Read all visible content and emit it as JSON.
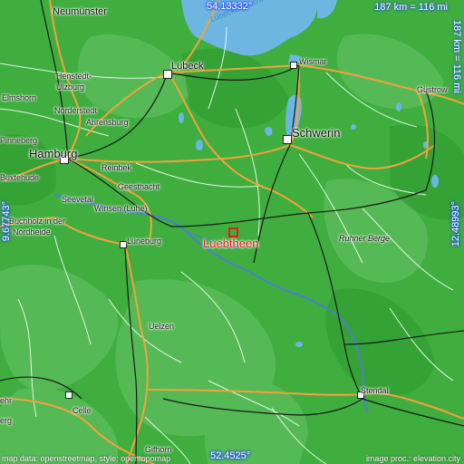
{
  "map": {
    "target": "Luebtheen",
    "colors": {
      "land": "#3fae3f",
      "land_light": "#6ec36e",
      "water": "#6db6e2",
      "road_main": "#f4a13c",
      "road_minor": "#ffffff",
      "rail": "#222222",
      "river": "#4c7fd0",
      "target": "#e81a1a"
    },
    "coords": {
      "top": "54.13332°",
      "bottom": "52.4525°",
      "left": "9.67743°",
      "right": "12.48993°"
    },
    "scale": {
      "horizontal": "187 km = 116 mi",
      "vertical": "187 km = 116 mi"
    },
    "attribution_left": "map data: openstreetmap, style: opentopomap",
    "attribution_right": "image proc.: elevation.city",
    "sea_label": "Lübecker Bucht",
    "places": {
      "neumunster": "Neumünster",
      "lubeck": "Lübeck",
      "wismar": "Wismar",
      "henstedt": "Henstedt-",
      "ulzburg": "Ulzburg",
      "norderstedt": "Norderstedt",
      "elmshorn": "Elmshorn",
      "ahrensburg": "Ahrensburg",
      "pinneberg": "Pinneberg",
      "hamburg": "Hamburg",
      "reinbek": "Reinbek",
      "buxtehude": "Buxtehude",
      "geesthacht": "Geesthacht",
      "seevetal": "Seevetal",
      "winsen": "Winsen (Luhe)",
      "buchholz": "Buchholz in der",
      "nordheide": "Nordheide",
      "luneburg": "Lüneburg",
      "schwerin": "Schwerin",
      "gustrow": "Güstrow",
      "ruhner": "Ruhner Berge",
      "uelzen": "Uelzen",
      "celle": "Celle",
      "ehr_fragment": "ehr",
      "erg_fragment": "erg",
      "gifhorn": "Gifhorn",
      "stendal": "Stendal"
    }
  }
}
